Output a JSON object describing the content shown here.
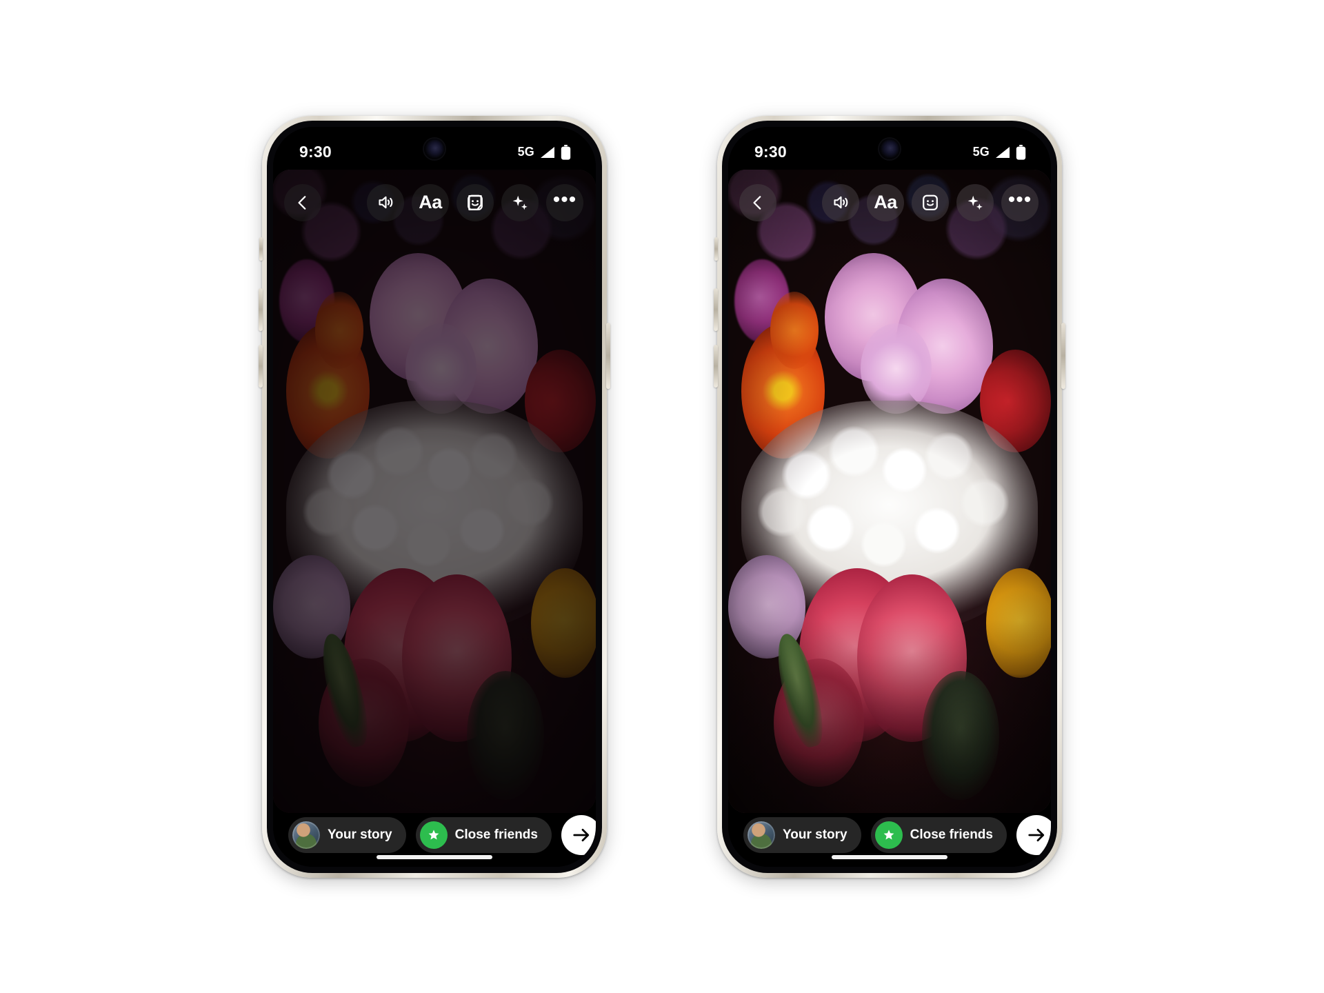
{
  "page": {
    "background_color": "#ffffff",
    "description": "Two smartphone mockups showing an Instagram story composer with a flower bouquet photo. Left device shows a dimmed preview, right device shows the brightened preview."
  },
  "devices": [
    {
      "id": "left-phone",
      "variant": "dimmed",
      "status_bar": {
        "time": "9:30",
        "network_label": "5G",
        "signal_icon": "signal-bars-icon",
        "battery_icon": "battery-full-icon",
        "camera_icon": "front-camera-icon"
      },
      "toolbar": {
        "back_label": "Back",
        "back_icon": "chevron-left-icon",
        "items": [
          {
            "icon": "volume-on-icon",
            "label": "Sound"
          },
          {
            "icon": "text-aa-icon",
            "label": "Aa"
          },
          {
            "icon": "sticker-smiley-icon",
            "label": "Stickers"
          },
          {
            "icon": "sparkle-effects-icon",
            "label": "Effects"
          },
          {
            "icon": "more-horizontal-icon",
            "label": "More"
          }
        ]
      },
      "bottom_bar": {
        "your_story_label": "Your story",
        "your_story_icon": "avatar-icon",
        "close_friends_label": "Close friends",
        "close_friends_icon": "close-friends-star-icon",
        "close_friends_color": "#2dbd4e",
        "send_label": "Send",
        "send_icon": "arrow-right-icon"
      }
    },
    {
      "id": "right-phone",
      "variant": "bright",
      "status_bar": {
        "time": "9:30",
        "network_label": "5G",
        "signal_icon": "signal-bars-icon",
        "battery_icon": "battery-full-icon",
        "camera_icon": "front-camera-icon"
      },
      "toolbar": {
        "back_label": "Back",
        "back_icon": "chevron-left-icon",
        "items": [
          {
            "icon": "volume-on-icon",
            "label": "Sound"
          },
          {
            "icon": "text-aa-icon",
            "label": "Aa"
          },
          {
            "icon": "sticker-smiley-icon",
            "label": "Stickers"
          },
          {
            "icon": "sparkle-effects-icon",
            "label": "Effects"
          },
          {
            "icon": "more-horizontal-icon",
            "label": "More"
          }
        ]
      },
      "bottom_bar": {
        "your_story_label": "Your story",
        "your_story_icon": "avatar-icon",
        "close_friends_label": "Close friends",
        "close_friends_icon": "close-friends-star-icon",
        "close_friends_color": "#2dbd4e",
        "send_label": "Send",
        "send_icon": "arrow-right-icon"
      }
    }
  ]
}
